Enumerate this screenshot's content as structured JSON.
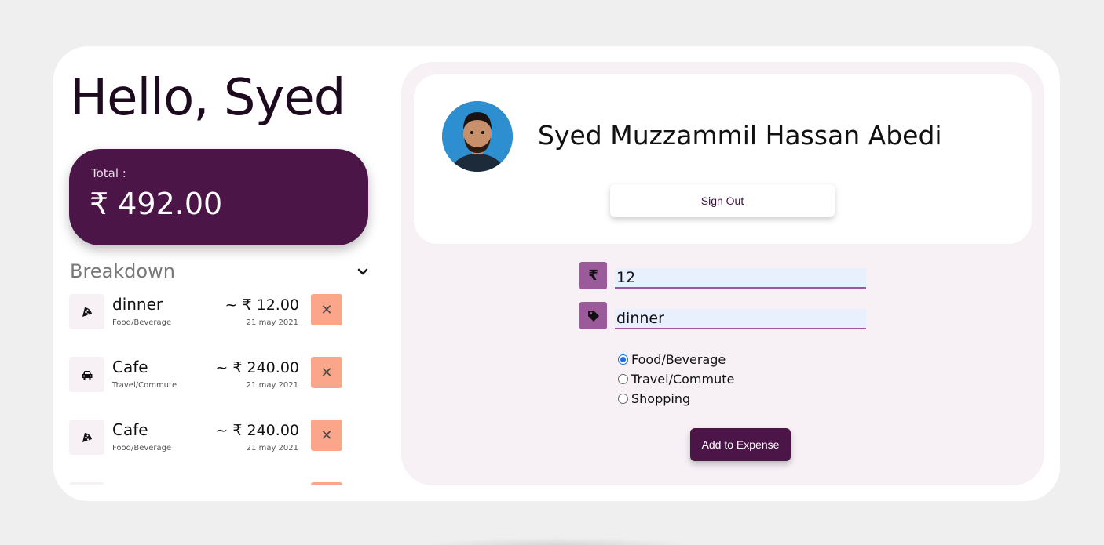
{
  "greeting": "Hello, Syed",
  "total": {
    "label": "Total :",
    "value": "₹ 492.00"
  },
  "breakdown": {
    "title": "Breakdown",
    "toggle_icon": "chevron-down-icon",
    "items": [
      {
        "name": "dinner",
        "category": "Food/Beverage",
        "amount": "~ ₹ 12.00",
        "date": "21 may 2021",
        "icon": "pizza-icon",
        "delete_icon": "close-icon"
      },
      {
        "name": "Cafe",
        "category": "Travel/Commute",
        "amount": "~ ₹ 240.00",
        "date": "21 may 2021",
        "icon": "car-icon",
        "delete_icon": "close-icon"
      },
      {
        "name": "Cafe",
        "category": "Food/Beverage",
        "amount": "~ ₹ 240.00",
        "date": "21 may 2021",
        "icon": "pizza-icon",
        "delete_icon": "close-icon"
      }
    ]
  },
  "profile": {
    "name": "Syed Muzzammil Hassan Abedi",
    "signout_label": "Sign Out"
  },
  "form": {
    "amount_icon": "₹",
    "amount_value": "12",
    "tag_icon": "tag-icon",
    "description_value": "dinner",
    "categories": [
      {
        "label": "Food/Beverage",
        "checked": true
      },
      {
        "label": "Travel/Commute",
        "checked": false
      },
      {
        "label": "Shopping",
        "checked": false
      }
    ],
    "submit_label": "Add to Expense"
  },
  "colors": {
    "accent": "#4b1548",
    "icon_bg": "#9b5a9a",
    "delete_bg": "#fba58a",
    "panel_bg": "#f7f1f6"
  }
}
